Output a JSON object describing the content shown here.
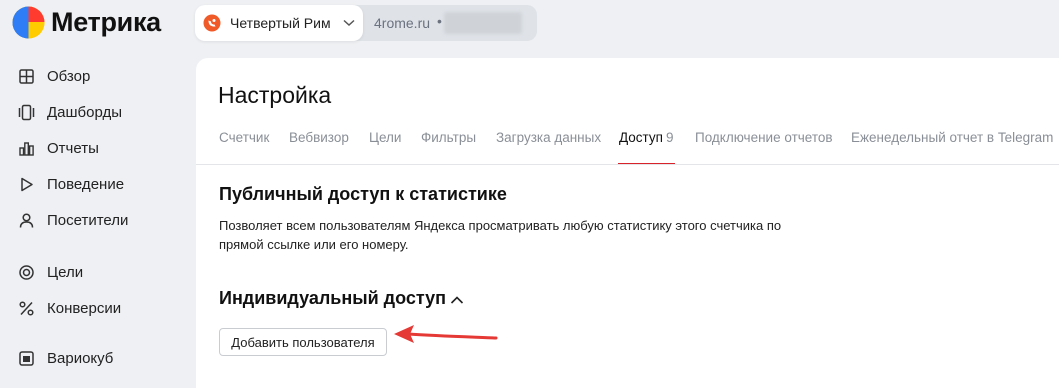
{
  "app": {
    "name": "Метрика"
  },
  "counter": {
    "name": "Четвертый Рим",
    "site": "4rome.ru",
    "separator": "•"
  },
  "sidebar": {
    "items": [
      {
        "label": "Обзор",
        "icon": "grid-icon"
      },
      {
        "label": "Дашборды",
        "icon": "dashboards-icon"
      },
      {
        "label": "Отчеты",
        "icon": "bar-chart-icon"
      },
      {
        "label": "Поведение",
        "icon": "play-icon"
      },
      {
        "label": "Посетители",
        "icon": "user-icon"
      },
      {
        "label": "Цели",
        "icon": "target-icon"
      },
      {
        "label": "Конверсии",
        "icon": "percent-icon"
      },
      {
        "label": "Вариокуб",
        "icon": "variocube-icon"
      }
    ]
  },
  "page": {
    "title": "Настройка",
    "tabs": [
      {
        "label": "Счетчик"
      },
      {
        "label": "Вебвизор"
      },
      {
        "label": "Цели"
      },
      {
        "label": "Фильтры"
      },
      {
        "label": "Загрузка данных"
      },
      {
        "label": "Доступ",
        "count": "9",
        "active": true
      },
      {
        "label": "Подключение отчетов"
      },
      {
        "label": "Еженедельный отчет в Telegram"
      }
    ]
  },
  "public_access": {
    "title": "Публичный доступ к статистике",
    "description_line1": "Позволяет всем пользователям Яндекса просматривать любую статистику этого счетчика по",
    "description_line2": "прямой ссылке или его номеру."
  },
  "individual_access": {
    "title": "Индивидуальный доступ",
    "expanded": true,
    "add_user_label": "Добавить пользователя"
  },
  "colors": {
    "accent": "#d8232a",
    "annotation_arrow": "#e53935",
    "background": "#eef0f3"
  }
}
